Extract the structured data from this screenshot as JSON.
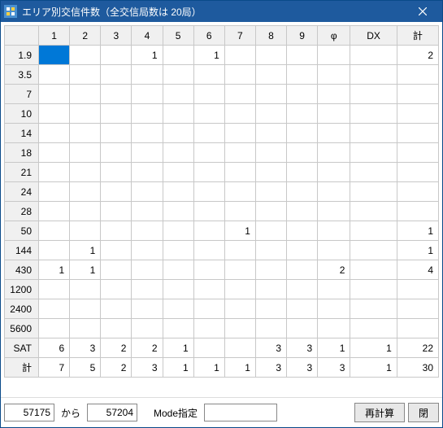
{
  "title": "エリア別交信件数（全交信局数は 20局）",
  "columns": [
    "1",
    "2",
    "3",
    "4",
    "5",
    "6",
    "7",
    "8",
    "9",
    "φ",
    "DX",
    "計"
  ],
  "rows": [
    {
      "hdr": "1.9",
      "cells": [
        "",
        "",
        "",
        "1",
        "",
        "1",
        "",
        "",
        "",
        "",
        "",
        "2"
      ],
      "sel": 0
    },
    {
      "hdr": "3.5",
      "cells": [
        "",
        "",
        "",
        "",
        "",
        "",
        "",
        "",
        "",
        "",
        "",
        ""
      ]
    },
    {
      "hdr": "7",
      "cells": [
        "",
        "",
        "",
        "",
        "",
        "",
        "",
        "",
        "",
        "",
        "",
        ""
      ]
    },
    {
      "hdr": "10",
      "cells": [
        "",
        "",
        "",
        "",
        "",
        "",
        "",
        "",
        "",
        "",
        "",
        ""
      ]
    },
    {
      "hdr": "14",
      "cells": [
        "",
        "",
        "",
        "",
        "",
        "",
        "",
        "",
        "",
        "",
        "",
        ""
      ]
    },
    {
      "hdr": "18",
      "cells": [
        "",
        "",
        "",
        "",
        "",
        "",
        "",
        "",
        "",
        "",
        "",
        ""
      ]
    },
    {
      "hdr": "21",
      "cells": [
        "",
        "",
        "",
        "",
        "",
        "",
        "",
        "",
        "",
        "",
        "",
        ""
      ]
    },
    {
      "hdr": "24",
      "cells": [
        "",
        "",
        "",
        "",
        "",
        "",
        "",
        "",
        "",
        "",
        "",
        ""
      ]
    },
    {
      "hdr": "28",
      "cells": [
        "",
        "",
        "",
        "",
        "",
        "",
        "",
        "",
        "",
        "",
        "",
        ""
      ]
    },
    {
      "hdr": "50",
      "cells": [
        "",
        "",
        "",
        "",
        "",
        "",
        "1",
        "",
        "",
        "",
        "",
        "1"
      ]
    },
    {
      "hdr": "144",
      "cells": [
        "",
        "1",
        "",
        "",
        "",
        "",
        "",
        "",
        "",
        "",
        "",
        "1"
      ]
    },
    {
      "hdr": "430",
      "cells": [
        "1",
        "1",
        "",
        "",
        "",
        "",
        "",
        "",
        "",
        "2",
        "",
        "4"
      ]
    },
    {
      "hdr": "1200",
      "cells": [
        "",
        "",
        "",
        "",
        "",
        "",
        "",
        "",
        "",
        "",
        "",
        ""
      ]
    },
    {
      "hdr": "2400",
      "cells": [
        "",
        "",
        "",
        "",
        "",
        "",
        "",
        "",
        "",
        "",
        "",
        ""
      ]
    },
    {
      "hdr": "5600",
      "cells": [
        "",
        "",
        "",
        "",
        "",
        "",
        "",
        "",
        "",
        "",
        "",
        ""
      ]
    },
    {
      "hdr": "SAT",
      "cells": [
        "6",
        "3",
        "2",
        "2",
        "1",
        "",
        "",
        "3",
        "3",
        "1",
        "1",
        "22"
      ]
    },
    {
      "hdr": "計",
      "cells": [
        "7",
        "5",
        "2",
        "3",
        "1",
        "1",
        "1",
        "3",
        "3",
        "3",
        "1",
        "30"
      ]
    }
  ],
  "footer": {
    "from": "57175",
    "kara": "から",
    "to": "57204",
    "mode_label": "Mode指定",
    "mode_value": "",
    "recalc": "再計算",
    "close": "閉"
  }
}
